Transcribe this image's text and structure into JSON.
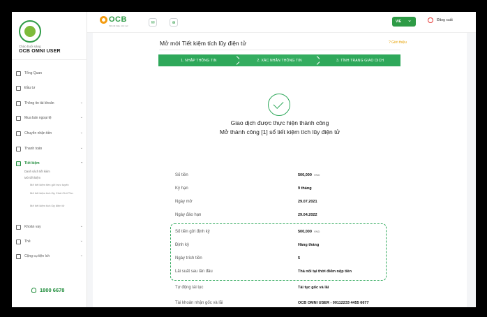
{
  "user": {
    "greeting": "Chào buổi sáng",
    "name": "OCB OMNI USER"
  },
  "sidebar": {
    "items": [
      {
        "label": "Tổng Quan",
        "chevron": false
      },
      {
        "label": "Đầu tư",
        "chevron": false
      },
      {
        "label": "Thông tin tài khoản",
        "chevron": true
      },
      {
        "label": "Mua bán ngoại tệ",
        "chevron": true
      },
      {
        "label": "Chuyển nhận tiền",
        "chevron": true
      },
      {
        "label": "Thanh toán",
        "chevron": true
      },
      {
        "label": "Tiết kiệm",
        "chevron": true
      },
      {
        "label": "Khoản vay",
        "chevron": true
      },
      {
        "label": "Thẻ",
        "chevron": true
      },
      {
        "label": "Cộng cụ tiện ích",
        "chevron": true
      }
    ],
    "chevron_glyph": "⌄",
    "savings_sub": {
      "list": "Danh sách tiết kiệm",
      "open": "Mở tiết kiệm",
      "open_items": [
        "Mở tiết kiệm tiền gửi trực tuyến",
        "Mở tiết kiệm tích lũy Chút Chít Tôn",
        "Mở tiết kiệm tích lũy điện tử"
      ]
    },
    "hotline": "1800 6678"
  },
  "topbar": {
    "brand": "OCB",
    "brand_tagline": "Kết nối triệu ước mơ",
    "mail_icon_glyph": "✉",
    "cart_icon_glyph": "⊕",
    "language": "VIE",
    "language_chevron": "⌄",
    "logout": "Đăng xuất"
  },
  "page": {
    "title": "Mở mới Tiết kiệm tích lũy điện tử",
    "guide": "? Giới thiệu",
    "steps": [
      "1. NHẬP THÔNG TIN",
      "2. XÁC NHẬN THÔNG TIN",
      "3. TÌNH TRẠNG GIAO DỊCH"
    ],
    "success_line1": "Giao dịch được thực hiện thành công",
    "success_line2": "Mở thành công [1] sổ tiết kiệm tích lũy điện tử"
  },
  "details": [
    {
      "label": "Số tiền",
      "value": "500,000",
      "unit": "VND"
    },
    {
      "label": "Kỳ hạn",
      "value": "9 tháng",
      "unit": ""
    },
    {
      "label": "Ngày mở",
      "value": "29.07.2021",
      "unit": ""
    },
    {
      "label": "Ngày đáo hạn",
      "value": "29.04.2022",
      "unit": ""
    },
    {
      "label": "Số tiền gửi định kỳ",
      "value": "500,000",
      "unit": "VND"
    },
    {
      "label": "Định kỳ",
      "value": "Hàng tháng",
      "unit": ""
    },
    {
      "label": "Ngày trích tiền",
      "value": "5",
      "unit": ""
    },
    {
      "label": "Lãi suất sau lần đầu",
      "value": "Thả nổi tại thời điểm nộp tiền",
      "unit": ""
    },
    {
      "label": "Tự động tái tục",
      "value": "Tái tục gốc và lãi",
      "unit": ""
    },
    {
      "label": "Tài khoản nhận gốc và lãi",
      "value": "OCB OMNI USER - 00112233 4455 6677",
      "unit": ""
    }
  ],
  "colors": {
    "brand_green": "#2e9b46",
    "step_green": "#2ea85a",
    "accent_orange": "#f39c12",
    "logout_red": "#e53935"
  }
}
